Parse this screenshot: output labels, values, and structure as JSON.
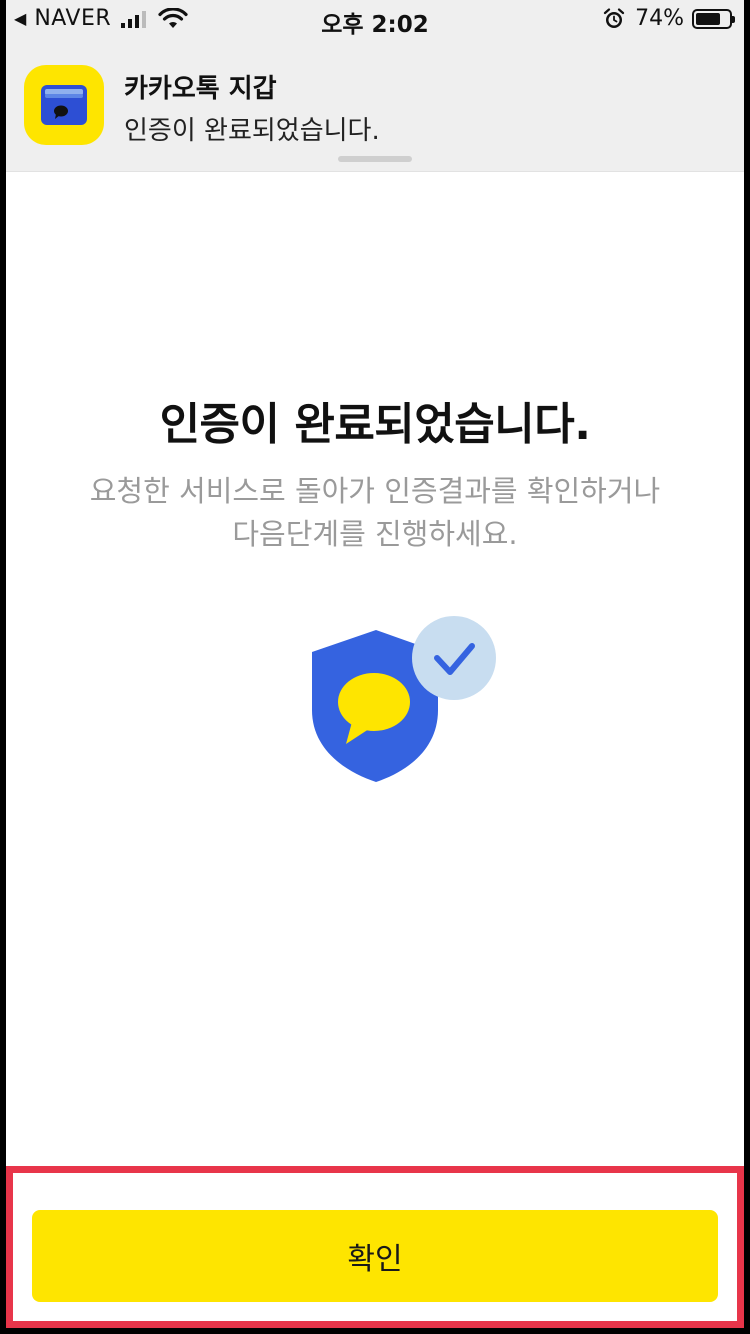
{
  "status_bar": {
    "back_app": "NAVER",
    "time": "오후 2:02",
    "battery": "74%",
    "battery_level": 0.74,
    "icons": [
      "back-arrow-icon",
      "signal-icon",
      "wifi-icon",
      "alarm-icon",
      "battery-icon"
    ]
  },
  "notification": {
    "app_name": "카카오톡 지갑",
    "message": "인증이 완료되었습니다.",
    "icon": "wallet-app-icon"
  },
  "main": {
    "title": "인증이 완료되었습니다.",
    "description_lines": [
      "요청한 서비스로 돌아가 인증결과를 확인하거나",
      "다음단계를 진행하세요."
    ],
    "illustration_icon": "shield-check-icon"
  },
  "footer": {
    "confirm_label": "확인"
  },
  "colors": {
    "accent_yellow": "#fee500",
    "shield_blue": "#3563e0",
    "check_bg": "#c8ddf0",
    "highlight_red": "#e8354a"
  }
}
